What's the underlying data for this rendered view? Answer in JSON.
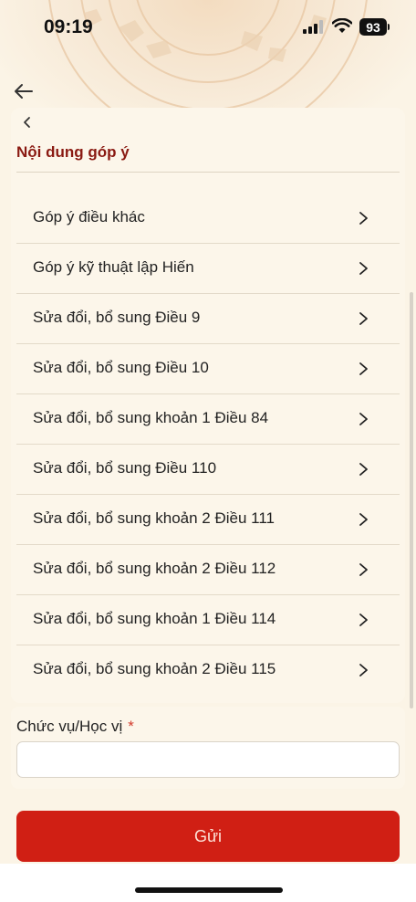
{
  "status_bar": {
    "time": "09:19",
    "battery": "93",
    "signal_icon": "cellular-signal-icon",
    "wifi_icon": "wifi-icon"
  },
  "nav": {
    "back_icon": "arrow-left-icon",
    "collapse_icon": "chevron-left-icon"
  },
  "section": {
    "title": "Nội dung góp ý"
  },
  "items": [
    {
      "label": "Góp ý điều khác"
    },
    {
      "label": "Góp ý kỹ thuật lập Hiến"
    },
    {
      "label": "Sửa đổi, bổ sung Điều 9"
    },
    {
      "label": "Sửa đổi, bổ sung Điều 10"
    },
    {
      "label": "Sửa đổi, bổ sung khoản 1 Điều 84"
    },
    {
      "label": "Sửa đổi, bổ sung Điều 110"
    },
    {
      "label": "Sửa đổi, bổ sung khoản 2 Điều 111"
    },
    {
      "label": "Sửa đổi, bổ sung khoản 2 Điều 112"
    },
    {
      "label": "Sửa đổi, bổ sung khoản 1 Điều 114"
    },
    {
      "label": "Sửa đổi, bổ sung khoản 2 Điều 115"
    }
  ],
  "form": {
    "position_label": "Chức vụ/Học vị",
    "required_mark": "*",
    "position_value": "",
    "submit_label": "Gửi"
  },
  "colors": {
    "accent": "#d01f14",
    "title": "#8a1a12",
    "background": "#fbf4e6"
  }
}
